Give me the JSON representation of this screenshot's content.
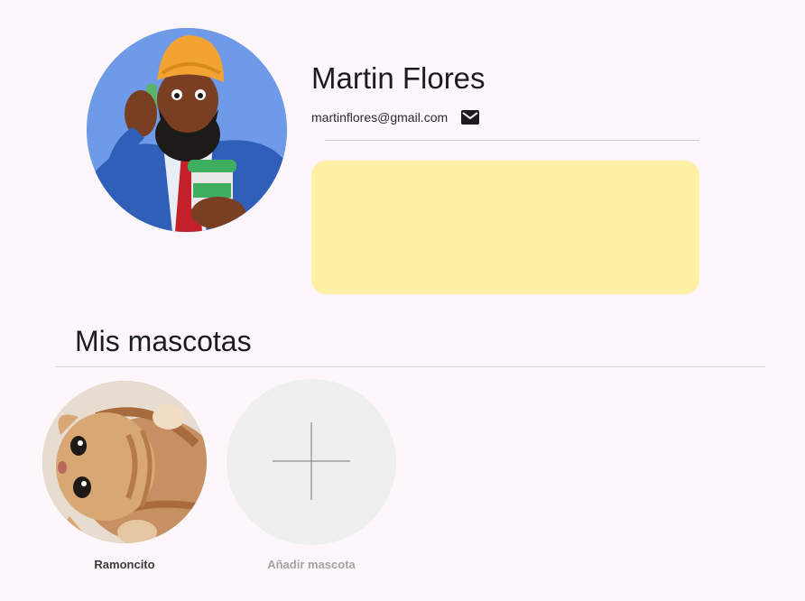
{
  "profile": {
    "name": "Martin Flores",
    "email": "martinflores@gmail.com",
    "avatar_icon": "user-avatar-illustration",
    "email_icon": "mail-icon",
    "bio_card_color": "#fff0a6"
  },
  "pets_section": {
    "title": "Mis mascotas",
    "pets": [
      {
        "name": "Ramoncito",
        "photo": "kitten-photo"
      }
    ],
    "add_label": "Añadir mascota",
    "add_icon": "plus-icon"
  },
  "colors": {
    "background": "#fdf7fc",
    "text": "#1c1b1f",
    "muted_text": "#a3a3a3",
    "add_circle": "#efefef"
  }
}
